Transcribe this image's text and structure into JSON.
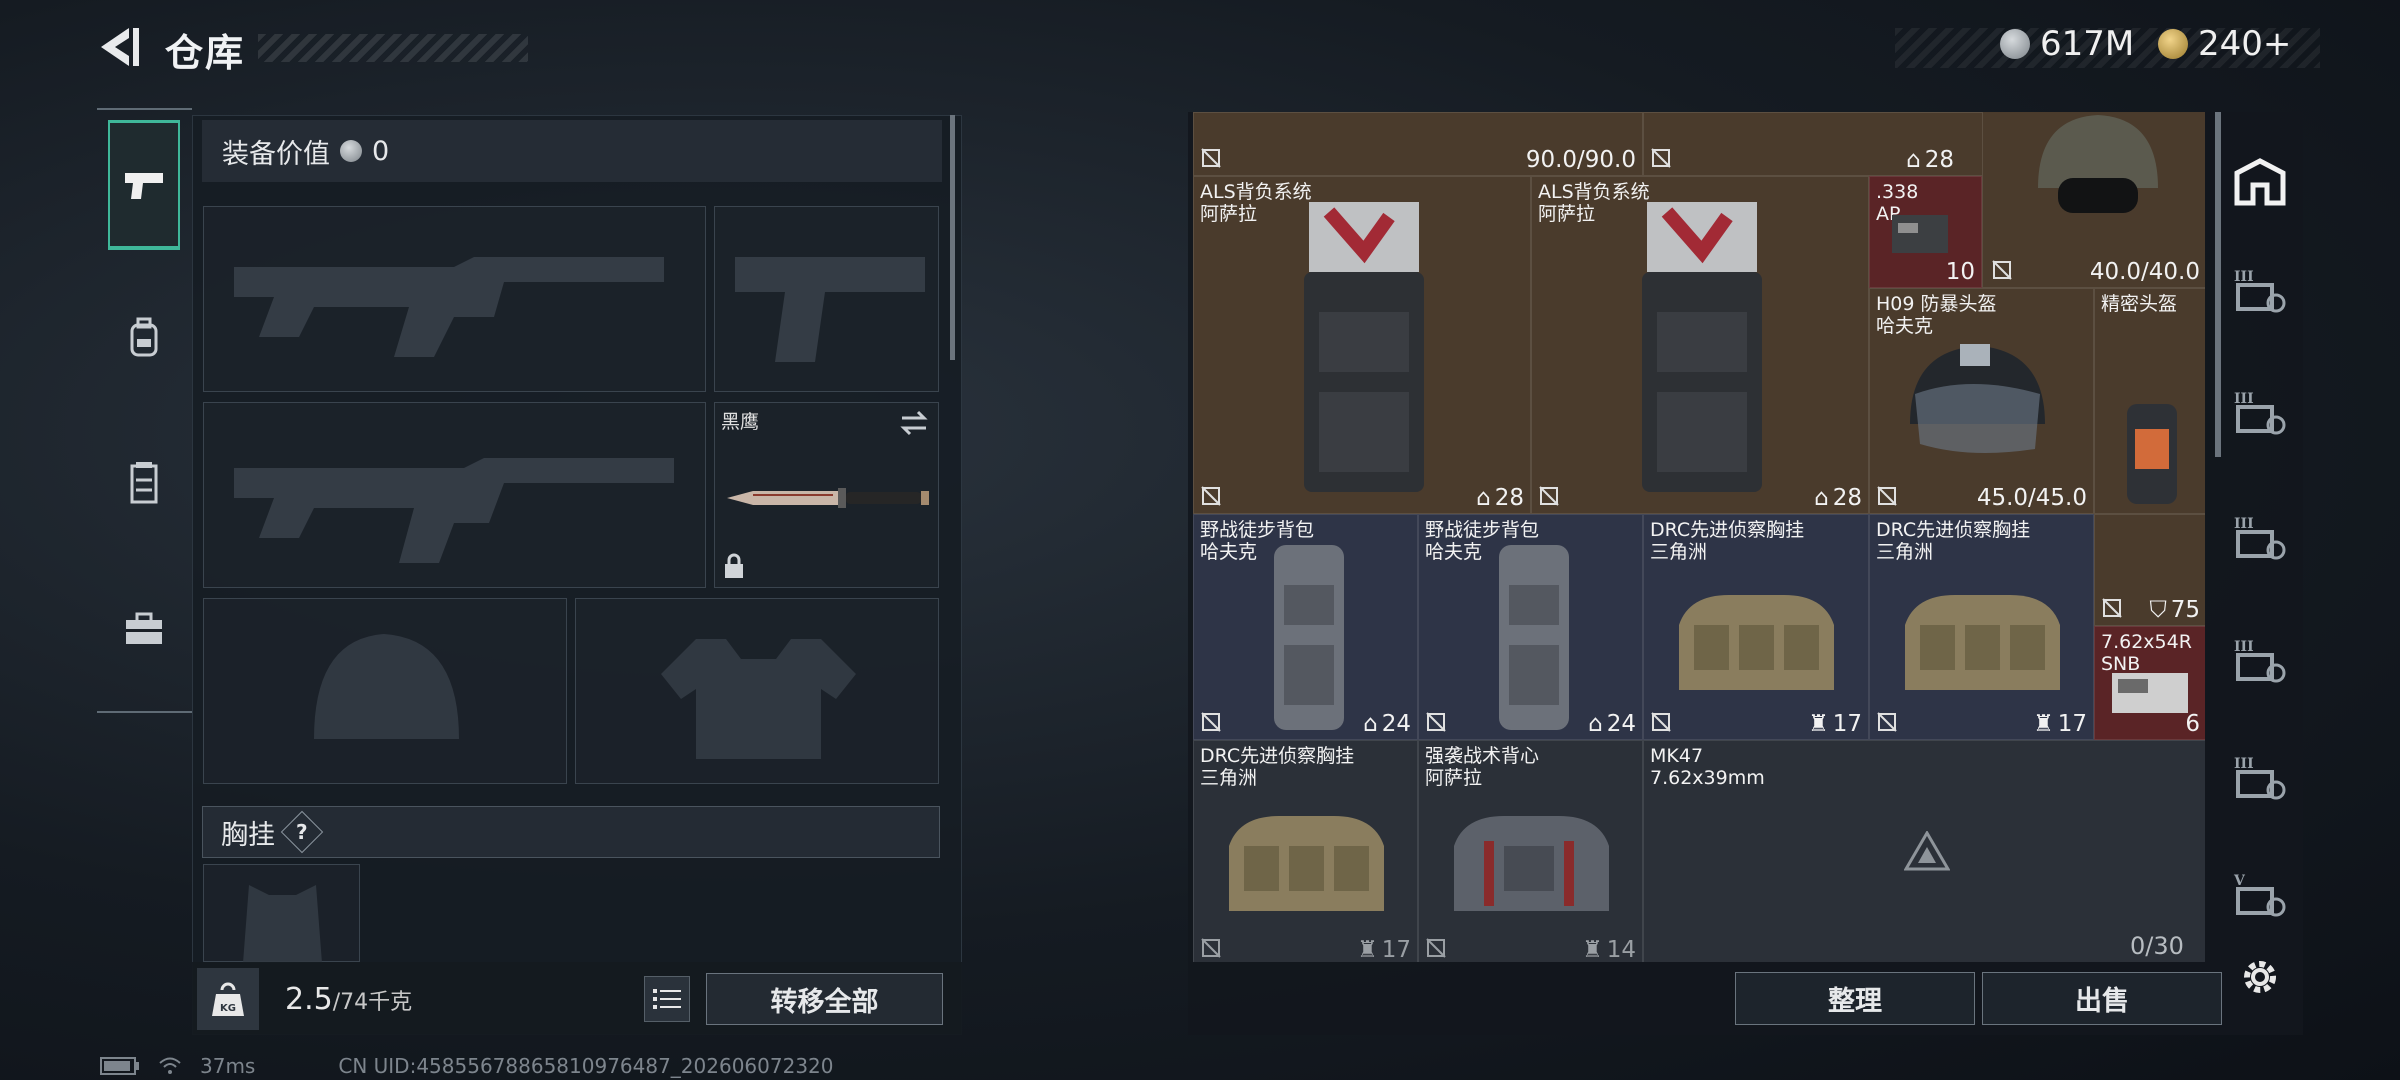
{
  "header": {
    "title": "仓库",
    "currency_a": "617M",
    "currency_b": "240+"
  },
  "tabs": [
    {
      "name": "weapons",
      "icon": "pistol-icon",
      "active": true
    },
    {
      "name": "gear",
      "icon": "backpack-icon",
      "active": false
    },
    {
      "name": "chest",
      "icon": "vest-icon",
      "active": false
    },
    {
      "name": "items",
      "icon": "briefcase-icon",
      "active": false
    }
  ],
  "loadout": {
    "value_label": "装备价值",
    "value": "0",
    "melee_name": "黑鹰",
    "chest_label": "胸挂",
    "chest_help": "?",
    "weight_current": "2.5",
    "weight_max": "/74千克",
    "kg_icon_label": "KG",
    "transfer_all": "转移全部"
  },
  "warehouse": {
    "top_row": {
      "durability": "90.0/90.0",
      "count": "28"
    },
    "items": [
      {
        "name": "ALS背负系统",
        "sub": "阿萨拉",
        "count": "28"
      },
      {
        "name": "ALS背负系统",
        "sub": "阿萨拉",
        "count": "28"
      },
      {
        "name": ".338",
        "sub": "AP",
        "count": "10"
      },
      {
        "name": "",
        "sub": "",
        "durability": "40.0/40.0"
      },
      {
        "name": "H09 防暴头盔",
        "sub": "哈夫克",
        "durability": "45.0/45.0"
      },
      {
        "name": "精密头盔",
        "sub": ""
      },
      {
        "name": "野战徒步背包",
        "sub": "哈夫克",
        "count": "24"
      },
      {
        "name": "野战徒步背包",
        "sub": "哈夫克",
        "count": "24"
      },
      {
        "name": "DRC先进侦察胸挂",
        "sub": "三角洲",
        "count": "17"
      },
      {
        "name": "DRC先进侦察胸挂",
        "sub": "三角洲",
        "count": "17"
      },
      {
        "name": "",
        "sub": "",
        "armor": "75"
      },
      {
        "name": "7.62x54R",
        "sub": "SNB",
        "count": "6"
      },
      {
        "name": "DRC先进侦察胸挂",
        "sub": "三角洲",
        "count": "17"
      },
      {
        "name": "强袭战术背心",
        "sub": "阿萨拉",
        "count": "14"
      },
      {
        "name": "MK47",
        "sub": "7.62x39mm"
      }
    ],
    "capacity": "0/30",
    "sort": "整理",
    "sell": "出售"
  },
  "side_icons": [
    "home-icon",
    "warehouse-iii-icon",
    "warehouse-iii-icon",
    "warehouse-iii-icon",
    "warehouse-iii-icon",
    "warehouse-iii-icon",
    "warehouse-v-icon",
    "settings-gear-icon"
  ],
  "side_roman": {
    "iii": "III",
    "v": "V"
  },
  "status": {
    "ping": "37ms",
    "uid": "CN UID:458556788658109764​87_202606072320"
  },
  "colors": {
    "accent": "#3fb89a",
    "brown_cell": "#4a3b2c",
    "navy_cell": "#2e3447",
    "red_cell": "#5a2426"
  }
}
